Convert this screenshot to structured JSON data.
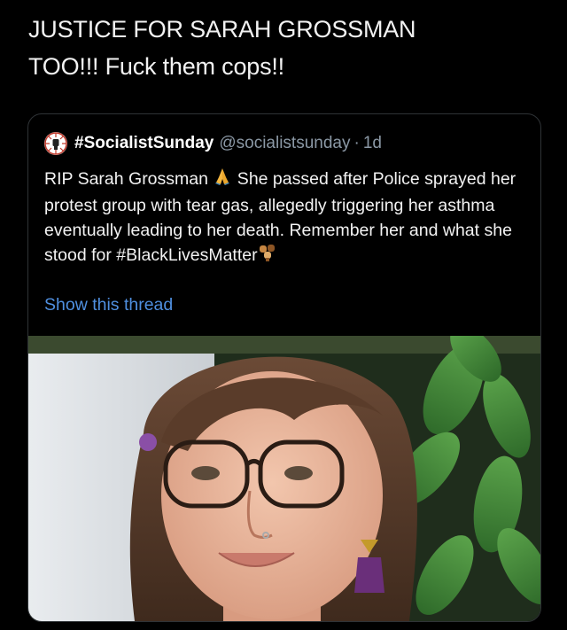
{
  "post": {
    "caption_line1": "JUSTICE FOR SARAH GROSSMAN",
    "caption_line2": "TOO!!! Fuck them cops!!"
  },
  "quoted_tweet": {
    "display_name": "#SocialistSunday",
    "handle": "@socialistsunday",
    "separator": "·",
    "time": "1d",
    "avatar_icon": "raised-fist-icon",
    "text_part1": "RIP Sarah Grossman",
    "text_emoji1": "praying-hands-icon",
    "text_part2": " She passed after Police sprayed her protest group with tear gas, allegedly triggering her asthma eventually leading to her death. Remember her and what she stood for #BlackLivesMatter",
    "text_emoji2": "raised-fists-icon",
    "show_thread": "Show this thread",
    "link_color": "#4f8fdf",
    "photo_description_icon": "portrait-photo"
  }
}
